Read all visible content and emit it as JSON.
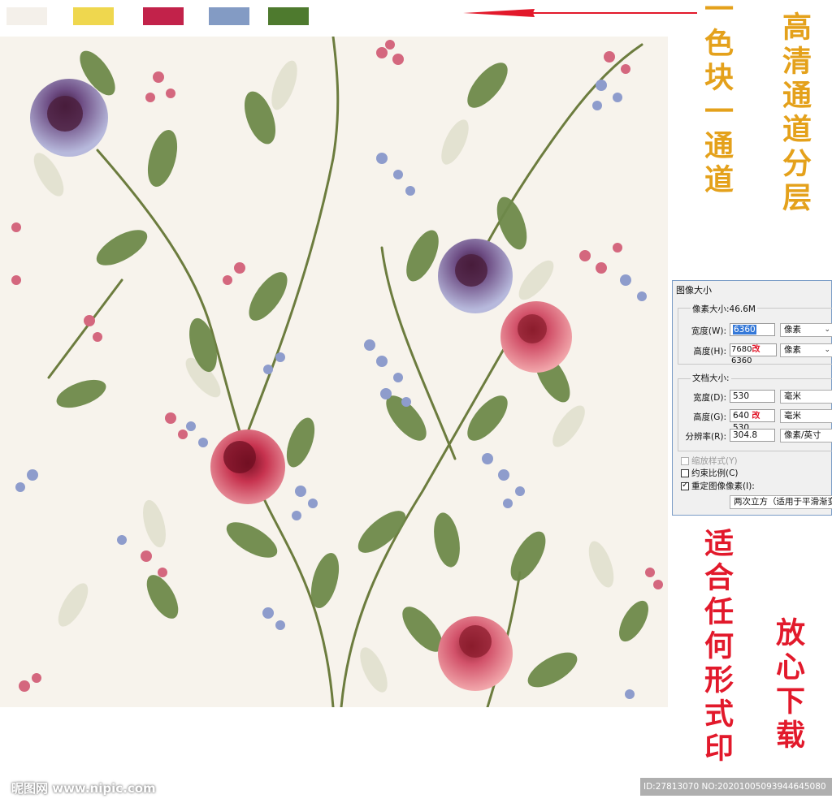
{
  "swatches": [
    {
      "name": "cream",
      "color": "#f4f0ea"
    },
    {
      "name": "yellow",
      "color": "#efd74e"
    },
    {
      "name": "crimson",
      "color": "#c2224a"
    },
    {
      "name": "steel-blue",
      "color": "#839bc4"
    },
    {
      "name": "olive-green",
      "color": "#4e7a2e"
    }
  ],
  "headlines": {
    "channel_block": "一色块一通道",
    "hd_layers": "高清通道分层",
    "any_print": "适合任何形式印",
    "download": "放心下载"
  },
  "dialog": {
    "title": "图像大小",
    "pixel_group_label": "像素大小:46.6M",
    "width_label": "宽度(W):",
    "width_value": "6360",
    "width_unit": "像素",
    "height_label": "高度(H):",
    "height_value_old": "7680",
    "height_mark": "改",
    "height_value_new": "6360",
    "height_unit": "像素",
    "doc_group_label": "文档大小:",
    "doc_width_label": "宽度(D):",
    "doc_width_value": "530",
    "doc_width_unit": "毫米",
    "doc_height_label": "高度(G):",
    "doc_height_value": "640",
    "doc_height_mark": "改",
    "doc_height_new": "530",
    "doc_height_unit": "毫米",
    "resolution_label": "分辨率(R):",
    "resolution_value": "304.8",
    "resolution_unit": "像素/英寸",
    "scale_styles": "缩放样式(Y)",
    "constrain": "约束比例(C)",
    "resample": "重定图像像素(I):",
    "resample_method": "两次立方（适用于平滑渐变"
  },
  "watermark": {
    "site": "昵图网 www.nipic.com",
    "id_text": "ID:27813070 NO:20201005093944645080"
  }
}
